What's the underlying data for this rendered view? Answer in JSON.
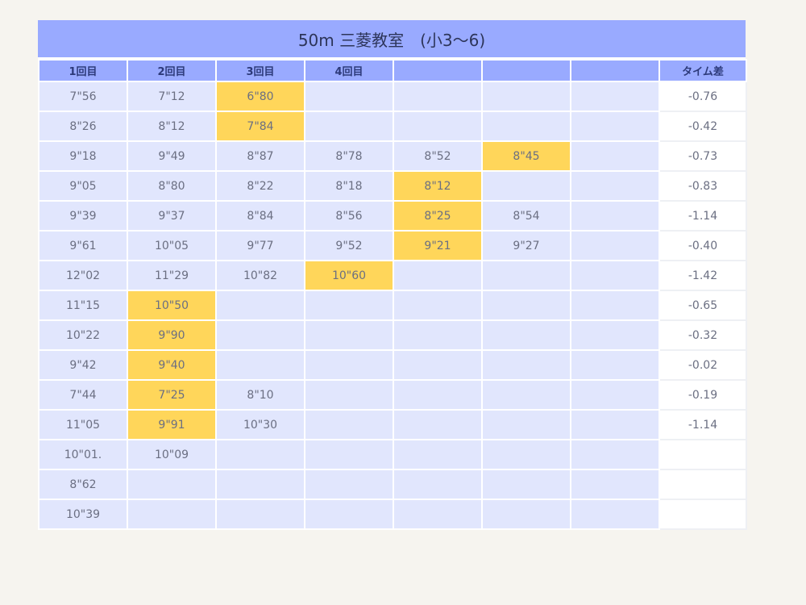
{
  "title": "50m 三菱教室　(小3〜6)",
  "headers": [
    "1回目",
    "2回目",
    "3回目",
    "4回目",
    "",
    "",
    "",
    "タイム差"
  ],
  "rows": [
    {
      "cells": [
        "7\"56",
        "7\"12",
        "6\"80",
        "",
        "",
        "",
        ""
      ],
      "highlight": 2,
      "diff": "-0.76"
    },
    {
      "cells": [
        "8\"26",
        "8\"12",
        "7\"84",
        "",
        "",
        "",
        ""
      ],
      "highlight": 2,
      "diff": "-0.42"
    },
    {
      "cells": [
        "9\"18",
        "9\"49",
        "8\"87",
        "8\"78",
        "8\"52",
        "8\"45",
        ""
      ],
      "highlight": 5,
      "diff": "-0.73"
    },
    {
      "cells": [
        "9\"05",
        "8\"80",
        "8\"22",
        "8\"18",
        "8\"12",
        "",
        ""
      ],
      "highlight": 4,
      "diff": "-0.83"
    },
    {
      "cells": [
        "9\"39",
        "9\"37",
        "8\"84",
        "8\"56",
        "8\"25",
        "8\"54",
        ""
      ],
      "highlight": 4,
      "diff": "-1.14"
    },
    {
      "cells": [
        "9\"61",
        "10\"05",
        "9\"77",
        "9\"52",
        "9\"21",
        "9\"27",
        ""
      ],
      "highlight": 4,
      "diff": "-0.40"
    },
    {
      "cells": [
        "12\"02",
        "11\"29",
        "10\"82",
        "10\"60",
        "",
        "",
        ""
      ],
      "highlight": 3,
      "diff": "-1.42"
    },
    {
      "cells": [
        "11\"15",
        "10\"50",
        "",
        "",
        "",
        "",
        ""
      ],
      "highlight": 1,
      "diff": "-0.65"
    },
    {
      "cells": [
        "10\"22",
        "9\"90",
        "",
        "",
        "",
        "",
        ""
      ],
      "highlight": 1,
      "diff": "-0.32"
    },
    {
      "cells": [
        "9\"42",
        "9\"40",
        "",
        "",
        "",
        "",
        ""
      ],
      "highlight": 1,
      "diff": "-0.02"
    },
    {
      "cells": [
        "7\"44",
        "7\"25",
        "8\"10",
        "",
        "",
        "",
        ""
      ],
      "highlight": 1,
      "diff": "-0.19"
    },
    {
      "cells": [
        "11\"05",
        "9\"91",
        "10\"30",
        "",
        "",
        "",
        ""
      ],
      "highlight": 1,
      "diff": "-1.14"
    },
    {
      "cells": [
        "10\"01.",
        "10\"09",
        "",
        "",
        "",
        "",
        ""
      ],
      "highlight": -1,
      "diff": ""
    },
    {
      "cells": [
        "8\"62",
        "",
        "",
        "",
        "",
        "",
        ""
      ],
      "highlight": -1,
      "diff": ""
    },
    {
      "cells": [
        "10\"39",
        "",
        "",
        "",
        "",
        "",
        ""
      ],
      "highlight": -1,
      "diff": ""
    }
  ],
  "colors": {
    "header_bg": "#99aaff",
    "cell_bg": "#e1e6fd",
    "highlight_bg": "#ffd65a",
    "diff_bg": "#ffffff"
  }
}
